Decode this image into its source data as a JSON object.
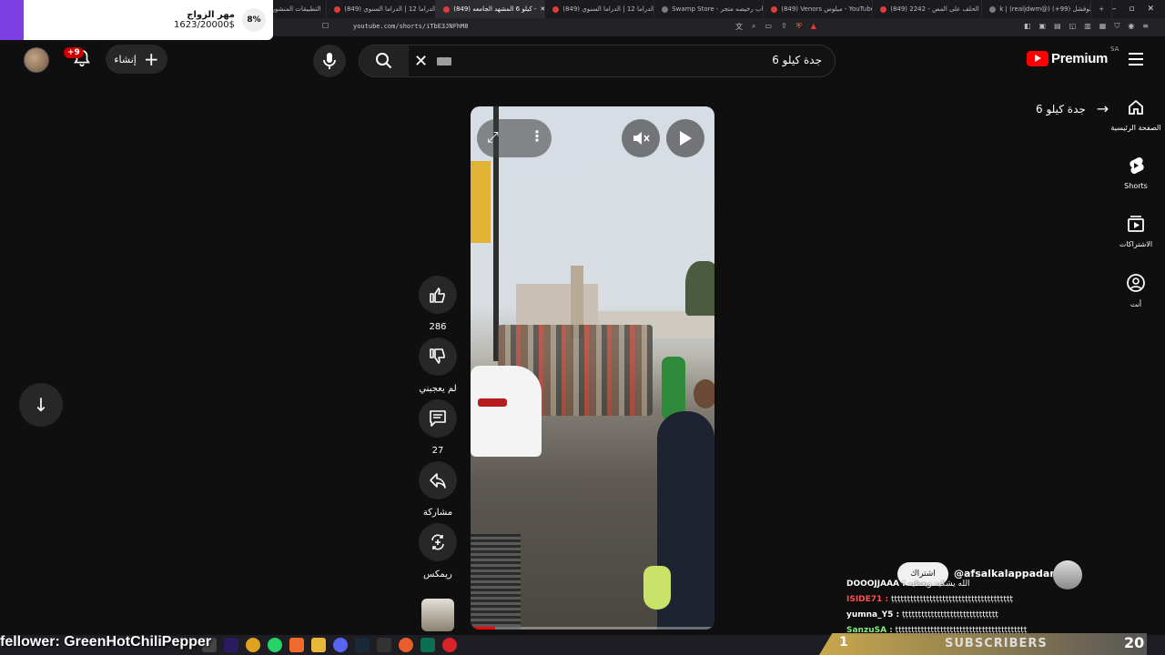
{
  "browser": {
    "tabs": [
      {
        "label": "التطبيقات المنشورة"
      },
      {
        "label": "(849) الدراما 12 | الدراما السنوي"
      },
      {
        "label": "(849) كيلو 6 المشهد الجامعه -",
        "active": true
      },
      {
        "label": "(849) اخلاز الدراما 12 | الدراما السنوي"
      },
      {
        "label": "Swamp Store - العاب رخيصه متجر"
      },
      {
        "label": "(849) Venors ميلوس - YouTube"
      },
      {
        "label": "(849) 2242 - حكم الحلف على المص"
      },
      {
        "label": "k | (realjdwm@) على لوفشل (99+)"
      }
    ],
    "url": "youtube.com/shorts/iTbE3JNFhM8"
  },
  "goal_overlay": {
    "title": "مهر الزواج",
    "amount": "1623/20000$",
    "percent": "8%"
  },
  "header": {
    "notification_count": "+9",
    "create_label": "إنشاء",
    "search_query": "جدة كيلو 6",
    "logo_text": "Premium",
    "region": "SA"
  },
  "guide": [
    {
      "icon": "home-icon",
      "label": "الصفحة الرئيسية"
    },
    {
      "icon": "shorts-icon",
      "label": "Shorts"
    },
    {
      "icon": "subscriptions-icon",
      "label": "الاشتراكات"
    },
    {
      "icon": "you-icon",
      "label": "أنت"
    }
  ],
  "breadcrumb": {
    "text": "جدة كيلو 6"
  },
  "actions": {
    "likes": "286",
    "dislike_label": "لم يعجبني",
    "comments": "27",
    "share_label": "مشاركة",
    "remix_label": "ريمكس"
  },
  "video": {
    "progress": 0.1
  },
  "channel": {
    "name": "@afsalkalappadan",
    "subscribe_label": "اشتراك"
  },
  "chat": [
    {
      "user": "DOOOJJAAA :",
      "msg": "الله يشكيه ويعطيه"
    },
    {
      "user": "ISIDE71 :",
      "msg": "ṭṭṭṭṭṭṭṭṭṭṭṭṭṭṭṭṭṭṭṭṭṭṭṭṭṭṭṭṭṭṭṭṭṭṭṭṭṭ"
    },
    {
      "user": "yumna_Y5 :",
      "msg": "ṭṭṭṭṭṭṭṭṭṭṭṭṭṭṭṭṭṭṭṭṭṭṭṭṭṭṭṭṭṭ"
    },
    {
      "user": "SanzuSA :",
      "msg": "ṭṭṭṭṭṭṭṭṭṭṭṭṭṭṭṭṭṭṭṭṭṭṭṭṭṭṭṭṭṭṭṭṭṭṭṭṭṭṭṭṭ"
    }
  ],
  "stream": {
    "follower_text": "fellower: GreenHotChiliPepper",
    "subs_label": "SUBSCRIBERS",
    "subs_count": "20",
    "subs_prefix": "1"
  }
}
